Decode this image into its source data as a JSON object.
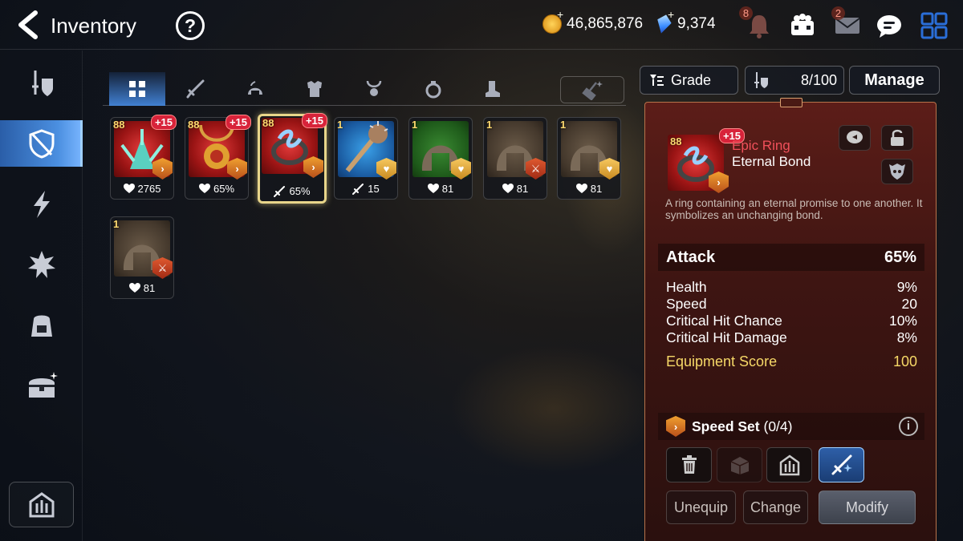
{
  "header": {
    "title": "Inventory",
    "help_label": "?",
    "gold": "46,865,876",
    "gems": "9,374",
    "currency_plus": "+",
    "notification_badge": "8",
    "mail_badge": "2"
  },
  "sidebar": {
    "items": [
      "equipment-icon",
      "unequipped-filter-icon",
      "artifact-icon",
      "catalyst-icon",
      "bag-icon",
      "chest-icon"
    ],
    "active_index": 1,
    "bottom": "armory-icon"
  },
  "tabs": {
    "items": [
      "all-icon",
      "weapon-icon",
      "helmet-icon",
      "armor-icon",
      "necklace-icon",
      "ring-icon",
      "boots-icon"
    ],
    "active_index": 0
  },
  "grid": {
    "items": [
      {
        "level": "88",
        "enhance": "+15",
        "set": "speed",
        "stat": "2765",
        "stat_icon": "health",
        "rarity": "epic"
      },
      {
        "level": "88",
        "enhance": "+15",
        "set": "speed",
        "stat": "65%",
        "stat_icon": "health",
        "rarity": "epic"
      },
      {
        "level": "88",
        "enhance": "+15",
        "set": "speed",
        "stat": "65%",
        "stat_icon": "attack",
        "rarity": "epic",
        "selected": true
      },
      {
        "level": "1",
        "enhance": "",
        "set": "health",
        "stat": "15",
        "stat_icon": "attack",
        "rarity": "blue"
      },
      {
        "level": "1",
        "enhance": "",
        "set": "health",
        "stat": "81",
        "stat_icon": "health",
        "rarity": "green"
      },
      {
        "level": "1",
        "enhance": "",
        "set": "attack",
        "stat": "81",
        "stat_icon": "health",
        "rarity": "normal"
      },
      {
        "level": "1",
        "enhance": "",
        "set": "health",
        "stat": "81",
        "stat_icon": "health",
        "rarity": "normal"
      },
      {
        "level": "1",
        "enhance": "",
        "set": "attack",
        "stat": "81",
        "stat_icon": "health",
        "rarity": "normal"
      }
    ]
  },
  "controls": {
    "grade_label": "Grade",
    "capacity": "8/100",
    "manage_label": "Manage"
  },
  "detail": {
    "level": "88",
    "enhance": "+15",
    "grade": "Epic Ring",
    "name": "Eternal Bond",
    "description": "A ring containing an eternal promise to one another. It symbolizes an unchanging bond.",
    "main_stat": {
      "label": "Attack",
      "value": "65%"
    },
    "sub_stats": [
      {
        "label": "Health",
        "value": "9%"
      },
      {
        "label": "Speed",
        "value": "20"
      },
      {
        "label": "Critical Hit Chance",
        "value": "10%"
      },
      {
        "label": "Critical Hit Damage",
        "value": "8%"
      }
    ],
    "score_label": "Equipment Score",
    "score_value": "100",
    "set_name": "Speed Set",
    "set_count": "(0/4)",
    "info_label": "i",
    "buttons": {
      "unequip": "Unequip",
      "change": "Change",
      "modify": "Modify"
    }
  },
  "colors": {
    "accent_blue": "#4b8fe0",
    "epic_red": "#f0505a",
    "score_gold": "#f6d867",
    "panel_border": "#b8734a"
  }
}
